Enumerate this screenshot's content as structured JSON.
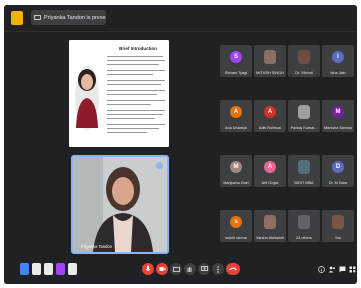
{
  "window": {
    "presenting_label": "Priyanka Tandon is presenting"
  },
  "slide": {
    "title": "Brief Introduction"
  },
  "camera": {
    "name": "Priyanka Tandon"
  },
  "participants": [
    {
      "name": "Shivani Tyagi",
      "initial": "S",
      "color": "#a142f4"
    },
    {
      "name": "MITUSH SINGH",
      "initial": "",
      "color": "#8d6e63"
    },
    {
      "name": "Dr. Vibhuti",
      "initial": "",
      "color": "#6d4c41"
    },
    {
      "name": "Isha Jain",
      "initial": "I",
      "color": "#5c6bc0"
    },
    {
      "name": "Anu Dhamija",
      "initial": "A",
      "color": "#e8710a"
    },
    {
      "name": "Aditi Rohtwal",
      "initial": "A",
      "color": "#d93025"
    },
    {
      "name": "Pankaj Kumar...",
      "initial": "",
      "color": "#9e9e9e"
    },
    {
      "name": "Manisha Sonwani",
      "initial": "M",
      "color": "#7b1fa2"
    },
    {
      "name": "Manjusha Goel",
      "initial": "M",
      "color": "#a1887f"
    },
    {
      "name": "Arit Goyal",
      "initial": "A",
      "color": "#f06292"
    },
    {
      "name": "BIGIT MBA",
      "initial": "",
      "color": "#546e7a"
    },
    {
      "name": "Dr. M Gaur",
      "initial": "D",
      "color": "#5c6bc0"
    },
    {
      "name": "sukriti verma",
      "initial": "s",
      "color": "#e8710a"
    },
    {
      "name": "Varsha Abhishek",
      "initial": "",
      "color": "#8d6e63"
    },
    {
      "name": "24 others",
      "initial": "",
      "color": "#5f6368"
    },
    {
      "name": "You",
      "initial": "",
      "color": "#795548"
    }
  ],
  "icons": {
    "left": [
      "reactions-icon",
      "captions-icon",
      "present-icon",
      "more-icon"
    ],
    "controls": [
      "mic-off-icon",
      "camera-off-icon",
      "captions-icon",
      "raise-hand-icon",
      "present-screen-icon",
      "more-options-icon",
      "hang-up-icon"
    ],
    "right": [
      "info-icon",
      "people-icon",
      "chat-icon",
      "activities-icon"
    ]
  },
  "colors": {
    "accent": "#8ab4f8",
    "danger": "#ea4335",
    "surface": "#3c4043"
  }
}
